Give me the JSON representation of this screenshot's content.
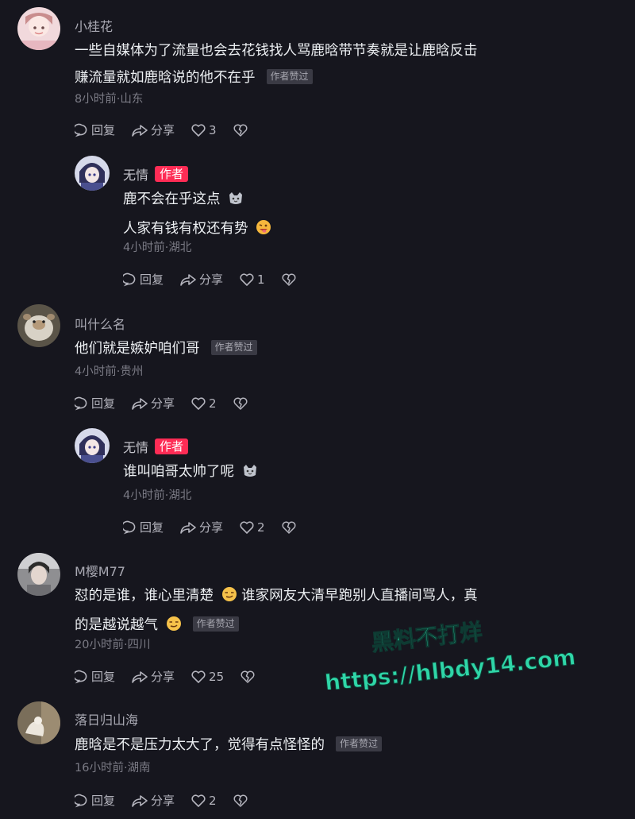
{
  "labels": {
    "reply": "回复",
    "share": "分享",
    "author_badge": "作者",
    "author_liked": "作者赞过"
  },
  "colors": {
    "background": "#16161e",
    "author_badge": "#fe2c55",
    "watermark": "#2fd6a8"
  },
  "comments": [
    {
      "username": "小桂花",
      "lines": [
        "一些自媒体为了流量也会去花钱找人骂鹿晗带节奏就是让鹿晗反击",
        "赚流量就如鹿晗说的他不在乎"
      ],
      "time_location": "8小时前·山东",
      "likes": "3",
      "author_liked": true,
      "replies": [
        {
          "username": "无情",
          "is_author": true,
          "lines": [
            "鹿不会在乎这点",
            "人家有钱有权还有势"
          ],
          "emoji_icons": [
            "cat-face-icon",
            "tongue-wink-emoji-icon"
          ],
          "time_location": "4小时前·湖北",
          "likes": "1"
        }
      ]
    },
    {
      "username": "叫什么名",
      "lines": [
        "他们就是嫉妒咱们哥"
      ],
      "time_location": "4小时前·贵州",
      "likes": "2",
      "author_liked": true,
      "replies": [
        {
          "username": "无情",
          "is_author": true,
          "lines": [
            "谁叫咱哥太帅了呢"
          ],
          "emoji_icons": [
            "cat-face-icon"
          ],
          "time_location": "4小时前·湖北",
          "likes": "2"
        }
      ]
    },
    {
      "username": "M樱M77",
      "lines": [
        "怼的是谁，谁心里清楚",
        "谁家网友大清早跑别人直播间骂人，真",
        "的是越说越气"
      ],
      "emoji_icons": [
        "smirk-emoji-icon"
      ],
      "time_location": "20小时前·四川",
      "likes": "25",
      "author_liked": true,
      "replies": []
    },
    {
      "username": "落日归山海",
      "lines": [
        "鹿晗是不是压力太大了，觉得有点怪怪的"
      ],
      "time_location": "16小时前·湖南",
      "likes": "2",
      "author_liked": true,
      "replies": []
    }
  ],
  "watermark": {
    "line1": "黑料不打烊",
    "line2": "https://hlbdy14.com"
  }
}
